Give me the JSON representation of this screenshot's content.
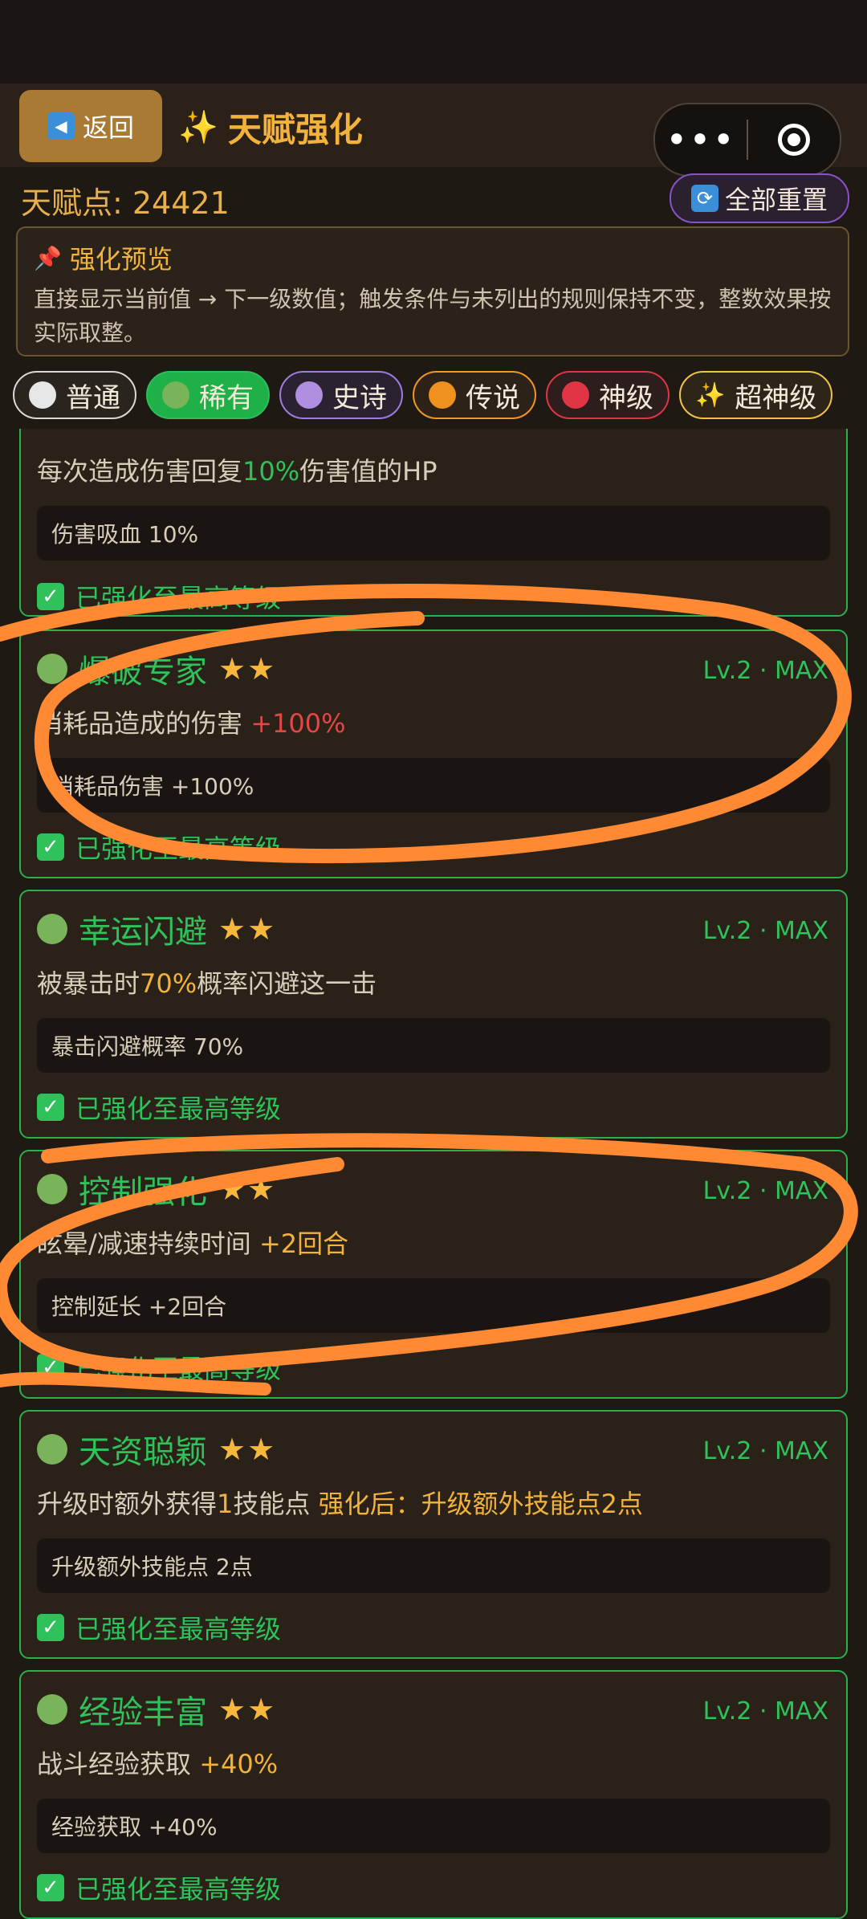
{
  "header": {
    "back_label": "返回",
    "title": "天赋强化",
    "back_icon": "left-triangle-icon",
    "capsule_more": "•••"
  },
  "points": {
    "label": "天赋点: 24421"
  },
  "reset_button": {
    "label": "全部重置",
    "icon": "refresh-icon"
  },
  "preview": {
    "title": "强化预览",
    "desc": "直接显示当前值 → 下一级数值；触发条件与未列出的规则保持不变，整数效果按实际取整。"
  },
  "filters": [
    {
      "label": "普通",
      "color": "#e6e6e6"
    },
    {
      "label": "稀有",
      "color": "#79b35a"
    },
    {
      "label": "史诗",
      "color": "#b08ee0"
    },
    {
      "label": "传说",
      "color": "#f0901e"
    },
    {
      "label": "神级",
      "color": "#e03545"
    },
    {
      "label": "超神级",
      "color": "#f7c948"
    }
  ],
  "cards": [
    {
      "effect_pre": "每次造成伤害回复",
      "effect_hl": "10%",
      "effect_post": "伤害值的HP",
      "stat": "伤害吸血 10%",
      "maxed": "已强化至最高等级"
    },
    {
      "name": "爆破专家",
      "stars": "★★",
      "level": "Lv.2 · MAX",
      "effect_pre": "消耗品造成的伤害 ",
      "effect_hl": "+100%",
      "effect_post": "",
      "stat": "消耗品伤害 +100%",
      "maxed": "已强化至最高等级"
    },
    {
      "name": "幸运闪避",
      "stars": "★★",
      "level": "Lv.2 · MAX",
      "effect_pre": "被暴击时",
      "effect_hl": "70%",
      "effect_post": "概率闪避这一击",
      "stat": "暴击闪避概率 70%",
      "maxed": "已强化至最高等级"
    },
    {
      "name": "控制强化",
      "stars": "★★",
      "level": "Lv.2 · MAX",
      "effect_pre": "眩晕/减速持续时间 ",
      "effect_hl": "+2回合",
      "effect_post": "",
      "stat": "控制延长 +2回合",
      "maxed": "已强化至最高等级"
    },
    {
      "name": "天资聪颖",
      "stars": "★★",
      "level": "Lv.2 · MAX",
      "effect_pre": "升级时额外获得",
      "effect_hl": "1",
      "effect_post": "技能点 ",
      "effect_extra": "强化后：升级额外技能点2点",
      "stat": "升级额外技能点 2点",
      "maxed": "已强化至最高等级"
    },
    {
      "name": "经验丰富",
      "stars": "★★",
      "level": "Lv.2 · MAX",
      "effect_pre": "战斗经验获取 ",
      "effect_hl": "+40%",
      "effect_post": "",
      "stat": "经验获取 +40%",
      "maxed": "已强化至最高等级"
    }
  ],
  "annotation_color": "#ff8a33"
}
